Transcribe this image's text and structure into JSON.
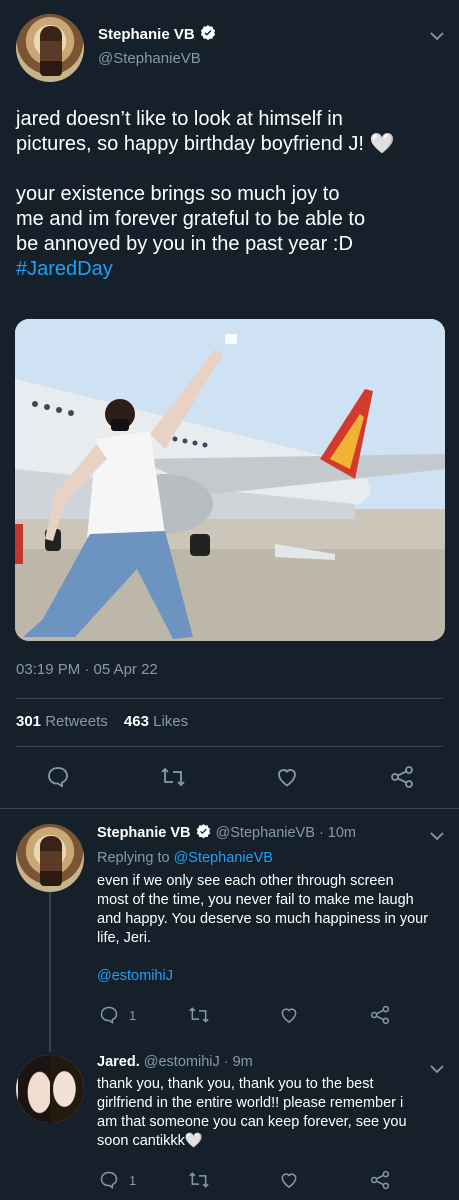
{
  "tweet": {
    "author_name": "Stephanie VB",
    "author_handle": "@StephanieVB",
    "text_line1": "jared doesn’t like to look at himself in",
    "text_line2": "pictures, so happy birthday boyfriend J! 🤍",
    "text_line3": "your existence brings so much joy to",
    "text_line4": "me and im forever grateful to be able to",
    "text_line5": "be annoyed by you in the past year :D",
    "hashtag": "#JaredDay",
    "timestamp": "03:19 PM · 05 Apr 22",
    "retweets_count": "301",
    "retweets_label": "Retweets",
    "likes_count": "463",
    "likes_label": "Likes"
  },
  "replies": [
    {
      "author_name": "Stephanie VB",
      "author_handle": "@StephanieVB",
      "time": "· 10m",
      "replying_prefix": "Replying to",
      "replying_to": "@StephanieVB",
      "line1": "even if we only see each other through screen",
      "line2": "most of the time, you never fail to make me laugh",
      "line3": "and happy. You deserve so much happiness in your",
      "line4": "life, Jeri.",
      "mention": "@estomihiJ",
      "reply_count": "1"
    },
    {
      "author_name": "Jared.",
      "author_handle": "@estomihiJ",
      "time": "· 9m",
      "line1": "thank you, thank you, thank you to the best",
      "line2": "girlfriend in the entire world!! please remember i",
      "line3": "am that someone you can keep forever, see you",
      "line4": "soon cantikkk🤍",
      "reply_count": "1"
    }
  ],
  "colors": {
    "background": "#15202b",
    "muted": "#8899a6",
    "link": "#1da1f2",
    "verified": "#ffffff"
  }
}
